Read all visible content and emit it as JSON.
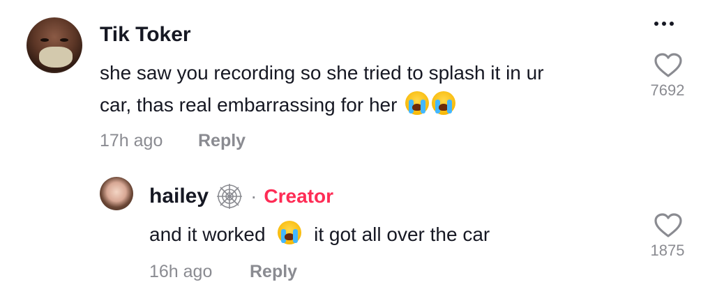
{
  "comment": {
    "username": "Tik Toker",
    "text_line1": "she saw you recording so she tried to splash it in ur",
    "text_line2": "car, thas real embarrassing for her",
    "emojis": [
      "loudly-crying-face-emoji",
      "loudly-crying-face-emoji"
    ],
    "time": "17h ago",
    "reply_label": "Reply",
    "like_count": "7692"
  },
  "reply": {
    "username": "hailey",
    "badge_icon": "spiderweb-emoji",
    "separator": "·",
    "creator_label": "Creator",
    "text_before": "and it worked",
    "emoji": "loudly-crying-face-emoji",
    "text_after": "it got all over the car",
    "time": "16h ago",
    "reply_label": "Reply",
    "like_count": "1875"
  },
  "icons": {
    "more": "more-horizontal-icon",
    "like": "heart-outline-icon"
  },
  "colors": {
    "creator": "#fe2c55",
    "muted": "#8a8b91",
    "text": "#161823"
  }
}
